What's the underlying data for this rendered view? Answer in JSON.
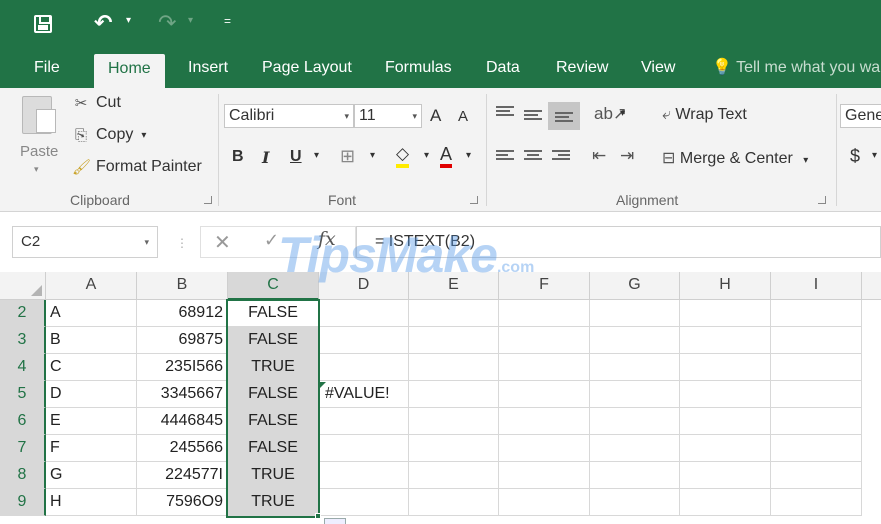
{
  "qat": {
    "save_icon": "save-icon",
    "undo_icon": "undo-icon",
    "redo_icon": "redo-icon",
    "caret": "▾",
    "customize": "="
  },
  "tabs": [
    {
      "label": "File"
    },
    {
      "label": "Home",
      "active": true
    },
    {
      "label": "Insert"
    },
    {
      "label": "Page Layout"
    },
    {
      "label": "Formulas"
    },
    {
      "label": "Data"
    },
    {
      "label": "Review"
    },
    {
      "label": "View"
    }
  ],
  "tellme": "Tell me what you wa",
  "ribbon": {
    "clipboard": {
      "paste": "Paste",
      "cut": "Cut",
      "copy": "Copy",
      "format_painter": "Format Painter",
      "label": "Clipboard"
    },
    "font": {
      "name": "Calibri",
      "size": "11",
      "grow": "A",
      "shrink": "A",
      "bold": "B",
      "italic": "I",
      "underline": "U",
      "font_color": "A",
      "label": "Font"
    },
    "alignment": {
      "wrap_text": "Wrap Text",
      "merge_center": "Merge & Center",
      "label": "Alignment"
    },
    "number": {
      "format": "Gene",
      "currency": "$"
    }
  },
  "formula_bar": {
    "name_box": "C2",
    "cancel": "✕",
    "enter": "✓",
    "fx": "fx",
    "formula": "= ISTEXT(B2)"
  },
  "watermark": {
    "text": "TipsMake",
    "suffix": ".com"
  },
  "columns": [
    "A",
    "B",
    "C",
    "D",
    "E",
    "F",
    "G",
    "H",
    "I"
  ],
  "selected_column": "C",
  "rows": [
    {
      "num": "2",
      "a": "A",
      "b": "68912",
      "c": "FALSE",
      "d": ""
    },
    {
      "num": "3",
      "a": "B",
      "b": "69875",
      "c": "FALSE",
      "d": ""
    },
    {
      "num": "4",
      "a": "C",
      "b": "235I566",
      "c": "TRUE",
      "d": ""
    },
    {
      "num": "5",
      "a": "D",
      "b": "3345667",
      "c": "FALSE",
      "d": "#VALUE!"
    },
    {
      "num": "6",
      "a": "E",
      "b": "4446845",
      "c": "FALSE",
      "d": ""
    },
    {
      "num": "7",
      "a": "F",
      "b": "245566",
      "c": "FALSE",
      "d": ""
    },
    {
      "num": "8",
      "a": "G",
      "b": "224577I",
      "c": "TRUE",
      "d": ""
    },
    {
      "num": "9",
      "a": "H",
      "b": "7596O9",
      "c": "TRUE",
      "d": ""
    }
  ],
  "colors": {
    "excel_green": "#217346",
    "ribbon_bg": "#f3f3f3",
    "selection_fill": "#d8d8d8"
  }
}
